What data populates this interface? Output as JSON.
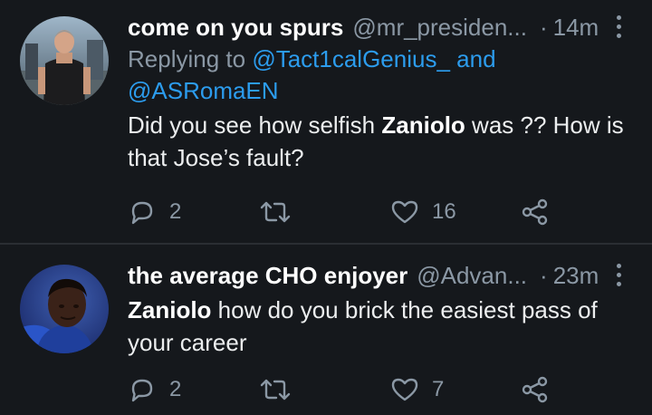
{
  "tweets": [
    {
      "display_name": "come on you spurs",
      "handle": "@mr_presiden...",
      "separator": "·",
      "time": "14m",
      "reply_prefix": "Replying to",
      "reply_mention_1": "@Tact1calGenius_",
      "reply_join": "and",
      "reply_mention_2": "@ASRomaEN",
      "text_before": "Did you see how selfish ",
      "text_bold": "Zaniolo",
      "text_after": " was ?? How is that Jose’s fault?",
      "replies": "2",
      "retweets": "",
      "likes": "16"
    },
    {
      "display_name": "the average CHO enjoyer",
      "handle": "@Advan...",
      "separator": "·",
      "time": "23m",
      "text_before": "",
      "text_bold": "Zaniolo",
      "text_after": " how do you brick the easiest pass of your career",
      "replies": "2",
      "retweets": "",
      "likes": "7"
    }
  ],
  "icons": {
    "reply": "reply-icon",
    "retweet": "retweet-icon",
    "like": "heart-icon",
    "share": "share-icon",
    "more": "more-vertical-icon"
  },
  "colors": {
    "background": "#15181c",
    "text": "#e8eaeb",
    "secondary": "#8b98a5",
    "mention": "#2c9ced",
    "divider": "#2a2e33"
  }
}
